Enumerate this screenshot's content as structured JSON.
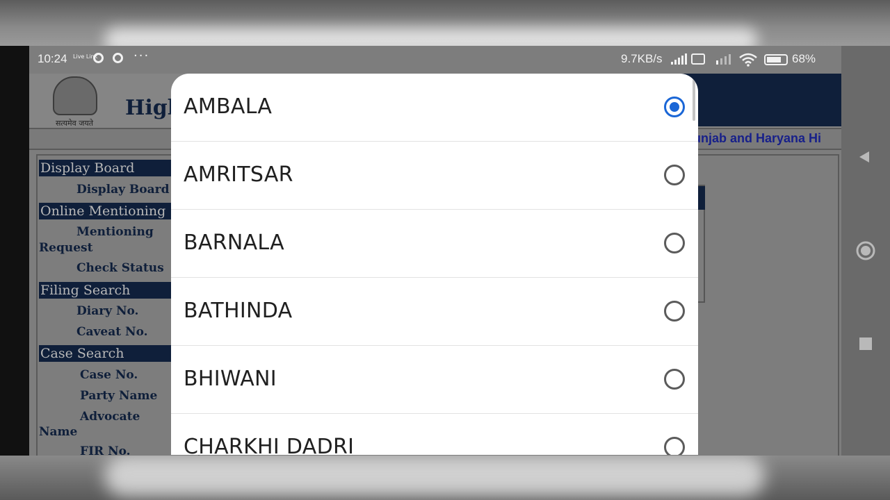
{
  "status_bar": {
    "time": "10:24",
    "mini_badge": "Live Link",
    "dots": "···",
    "network_speed": "9.7KB/s",
    "battery_percent": "68%"
  },
  "background_page": {
    "title_fragment": "High",
    "motto": "सत्यमेव जयते",
    "marquee": "unjab and Haryana Hi",
    "sidebar": {
      "sections": [
        {
          "label": "Display Board"
        },
        {
          "label": "Online Mentioning"
        },
        {
          "label": "Filing Search"
        },
        {
          "label": "Case Search"
        }
      ],
      "items": [
        {
          "label": "Display Board"
        },
        {
          "label": "Mentioning"
        },
        {
          "label": "Request"
        },
        {
          "label": "Check Status"
        },
        {
          "label": "Diary No."
        },
        {
          "label": "Caveat No."
        },
        {
          "label": "Case No."
        },
        {
          "label": "Party Name"
        },
        {
          "label": "Advocate"
        },
        {
          "label": "Name"
        },
        {
          "label": "FIR No."
        }
      ]
    }
  },
  "district_picker": {
    "options": [
      {
        "label": "AMBALA",
        "selected": true
      },
      {
        "label": "AMRITSAR",
        "selected": false
      },
      {
        "label": "BARNALA",
        "selected": false
      },
      {
        "label": "BATHINDA",
        "selected": false
      },
      {
        "label": "BHIWANI",
        "selected": false
      },
      {
        "label": "CHARKHI DADRI",
        "selected": false
      }
    ]
  },
  "nav_buttons": [
    "back",
    "home",
    "recents"
  ],
  "colors": {
    "accent": "#1a66d6",
    "site_navy": "#0f1f3a",
    "marquee": "#17208a"
  }
}
